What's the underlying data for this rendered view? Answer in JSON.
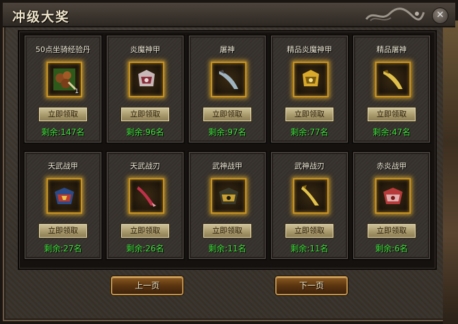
{
  "window": {
    "title": "冲级大奖"
  },
  "rewards": [
    {
      "name": "50点坐骑经验丹",
      "icon": "mount-exp-pill-icon",
      "count": "1",
      "button": "立即领取",
      "remaining": "剩余:147名"
    },
    {
      "name": "炎魔神甲",
      "icon": "flame-demon-armor-icon",
      "count": "",
      "button": "立即领取",
      "remaining": "剩余:96名"
    },
    {
      "name": "屠神",
      "icon": "godslayer-blade-icon",
      "count": "",
      "button": "立即领取",
      "remaining": "剩余:97名"
    },
    {
      "name": "精品炎魔神甲",
      "icon": "premium-flame-demon-armor-icon",
      "count": "",
      "button": "立即领取",
      "remaining": "剩余:77名"
    },
    {
      "name": "精品屠神",
      "icon": "premium-godslayer-blade-icon",
      "count": "",
      "button": "立即领取",
      "remaining": "剩余:47名"
    },
    {
      "name": "天武战甲",
      "icon": "heavenly-war-armor-icon",
      "count": "",
      "button": "立即领取",
      "remaining": "剩余:27名"
    },
    {
      "name": "天武战刃",
      "icon": "heavenly-war-blade-icon",
      "count": "",
      "button": "立即领取",
      "remaining": "剩余:26名"
    },
    {
      "name": "武神战甲",
      "icon": "war-god-armor-icon",
      "count": "",
      "button": "立即领取",
      "remaining": "剩余:11名"
    },
    {
      "name": "武神战刃",
      "icon": "war-god-blade-icon",
      "count": "",
      "button": "立即领取",
      "remaining": "剩余:11名"
    },
    {
      "name": "赤炎战甲",
      "icon": "crimson-flame-armor-icon",
      "count": "",
      "button": "立即领取",
      "remaining": "剩余:6名"
    }
  ],
  "pagination": {
    "prev_label": "上一页",
    "next_label": "下一页"
  },
  "colors": {
    "remaining_text": "#3ee13a",
    "slot_border": "#c8921f"
  }
}
